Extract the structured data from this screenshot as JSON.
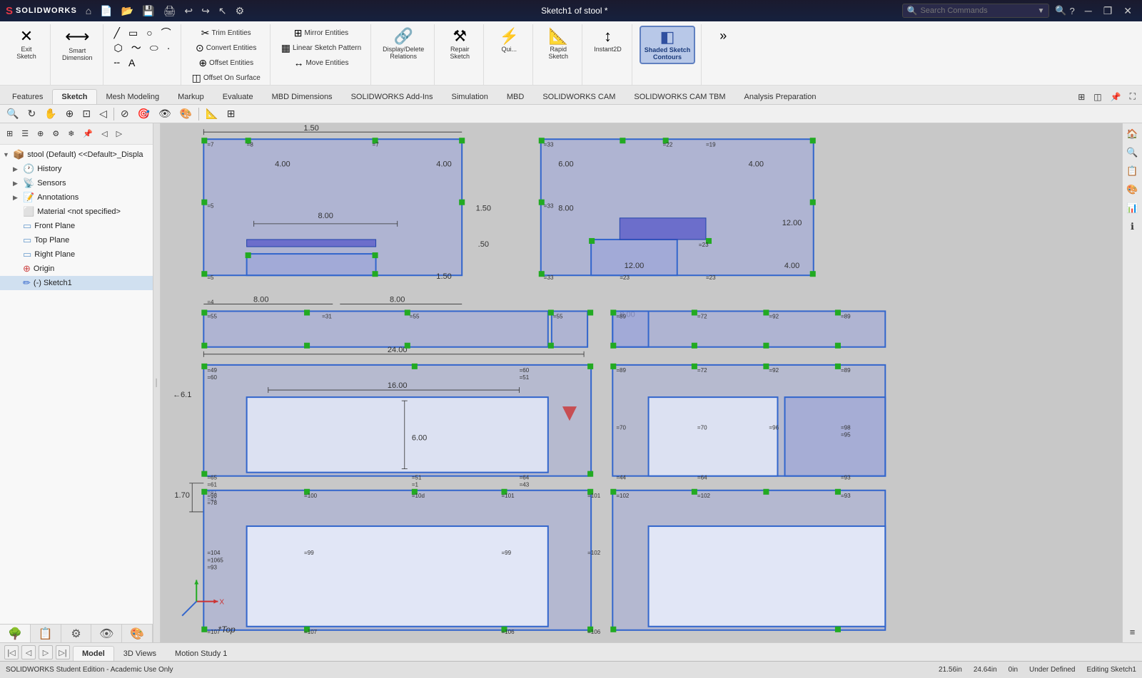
{
  "app": {
    "name": "SOLIDWORKS",
    "logo": "S",
    "edition": "Student Edition - Academic Use Only",
    "document_title": "Sketch1 of stool *"
  },
  "title_bar": {
    "search_placeholder": "Search Commands",
    "window_controls": [
      "minimize",
      "restore",
      "close"
    ]
  },
  "ribbon": {
    "groups": [
      {
        "name": "exit",
        "label": "",
        "buttons": [
          {
            "icon": "✕",
            "label": "Exit...",
            "large": true
          }
        ]
      },
      {
        "name": "smart-dim",
        "label": "",
        "buttons": [
          {
            "icon": "◇",
            "label": "Smart Dimension",
            "large": true
          }
        ]
      },
      {
        "name": "draw",
        "label": ""
      },
      {
        "name": "trim",
        "label": "",
        "buttons": [
          {
            "icon": "✂",
            "label": "Trim Entities"
          },
          {
            "icon": "⊙",
            "label": "Convert Entities"
          },
          {
            "icon": "⊕",
            "label": "Offset Entities"
          },
          {
            "icon": "◫",
            "label": "Offset On Surface"
          }
        ]
      },
      {
        "name": "mirror",
        "label": "",
        "buttons": [
          {
            "icon": "⊞",
            "label": "Mirror Entities"
          },
          {
            "icon": "▦",
            "label": "Linear Sketch Pattern"
          },
          {
            "icon": "↔",
            "label": "Move Entities"
          }
        ]
      },
      {
        "name": "display",
        "label": "",
        "buttons": [
          {
            "icon": "🔗",
            "label": "Display/Delete Relations"
          }
        ]
      },
      {
        "name": "repair",
        "label": "",
        "buttons": [
          {
            "icon": "⚒",
            "label": "Repair Sketch"
          }
        ]
      },
      {
        "name": "quick",
        "label": "",
        "buttons": [
          {
            "icon": "⚡",
            "label": "Qui..."
          }
        ]
      },
      {
        "name": "rapid",
        "label": "",
        "buttons": [
          {
            "icon": "⚡",
            "label": "Rapid Sketch"
          }
        ]
      },
      {
        "name": "instant2d",
        "label": "",
        "buttons": [
          {
            "icon": "↕",
            "label": "Instant2D"
          }
        ]
      },
      {
        "name": "shaded",
        "label": "",
        "buttons": [
          {
            "icon": "◧",
            "label": "Shaded Sketch Contours",
            "active": true
          }
        ]
      }
    ]
  },
  "tabs": {
    "items": [
      "Features",
      "Sketch",
      "Mesh Modeling",
      "Markup",
      "Evaluate",
      "MBD Dimensions",
      "SOLIDWORKS Add-Ins",
      "Simulation",
      "MBD",
      "SOLIDWORKS CAM",
      "SOLIDWORKS CAM TBM",
      "Analysis Preparation"
    ],
    "active": "Sketch"
  },
  "feature_tree": {
    "items": [
      {
        "label": "stool (Default) <<Default>_Displa",
        "level": 0,
        "icon": "📦",
        "expand": "▶"
      },
      {
        "label": "History",
        "level": 1,
        "icon": "🕐",
        "expand": "▶"
      },
      {
        "label": "Sensors",
        "level": 1,
        "icon": "📡",
        "expand": "▶"
      },
      {
        "label": "Annotations",
        "level": 1,
        "icon": "📝",
        "expand": "▶"
      },
      {
        "label": "Material <not specified>",
        "level": 1,
        "icon": "⬜",
        "expand": " "
      },
      {
        "label": "Front Plane",
        "level": 1,
        "icon": "▭",
        "expand": " "
      },
      {
        "label": "Top Plane",
        "level": 1,
        "icon": "▭",
        "expand": " "
      },
      {
        "label": "Right Plane",
        "level": 1,
        "icon": "▭",
        "expand": " "
      },
      {
        "label": "Origin",
        "level": 1,
        "icon": "⊕",
        "expand": " "
      },
      {
        "label": "(-) Sketch1",
        "level": 1,
        "icon": "✏",
        "expand": " "
      }
    ]
  },
  "bottom_tabs": {
    "items": [
      "Model",
      "3D Views",
      "Motion Study 1"
    ],
    "active": "Model"
  },
  "status_bar": {
    "left": "SOLIDWORKS Student Edition - Academic Use Only",
    "coords": {
      "x": "21.56in",
      "y": "24.64in",
      "z": "0in"
    },
    "under_defined": "Under Defined",
    "editing": "Editing Sketch1"
  },
  "canvas": {
    "view_label": "*Top",
    "dimensions": {
      "top_section": [
        "1.50",
        "4.00",
        "8.00",
        "1.50",
        "4.00",
        "8.00",
        "6.00",
        ".50",
        "12.00",
        "4.00"
      ],
      "mid_section": [
        "8.00",
        "8.00",
        "8.00",
        "24.00",
        "6.00",
        "16.00"
      ],
      "bottom_section": [
        "1.70"
      ]
    }
  },
  "right_panel": {
    "buttons": [
      "🏠",
      "⊕",
      "📋",
      "📊",
      "📈",
      "≡"
    ]
  }
}
